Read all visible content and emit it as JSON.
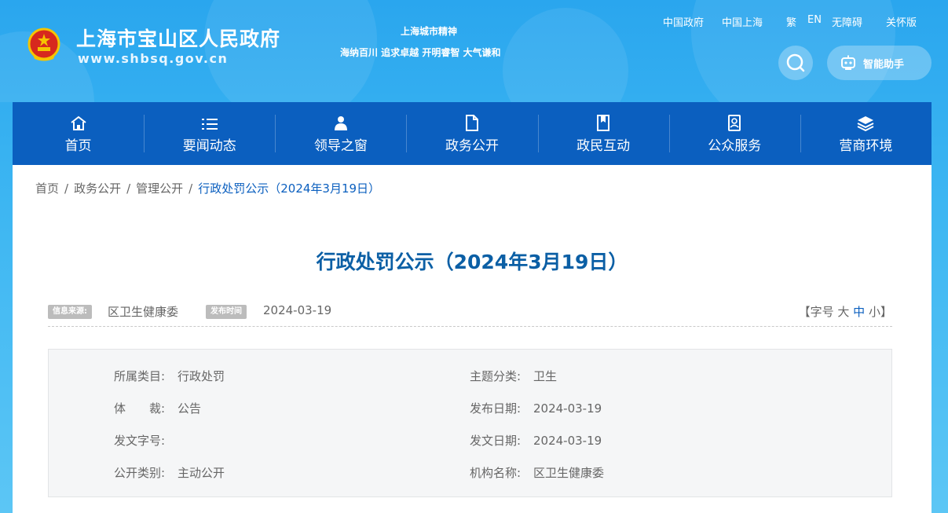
{
  "header": {
    "site_title": "上海市宝山区人民政府",
    "site_url": "www.shbsq.gov.cn",
    "spirit_title": "上海城市精神",
    "spirit_text": "海纳百川 追求卓越 开明睿智 大气谦和",
    "top_links": [
      "中国政府",
      "中国上海",
      "繁",
      "EN",
      "无障碍",
      "关怀版"
    ],
    "assistant_label": "智能助手",
    "icons": {
      "emblem": "national-emblem-icon",
      "search": "search-icon",
      "assistant": "robot-icon"
    }
  },
  "nav": {
    "items": [
      {
        "label": "首页",
        "icon": "home-icon"
      },
      {
        "label": "要闻动态",
        "icon": "list-icon"
      },
      {
        "label": "领导之窗",
        "icon": "person-icon"
      },
      {
        "label": "政务公开",
        "icon": "document-icon"
      },
      {
        "label": "政民互动",
        "icon": "bookmark-icon"
      },
      {
        "label": "公众服务",
        "icon": "service-icon"
      },
      {
        "label": "营商环境",
        "icon": "layers-icon"
      }
    ]
  },
  "breadcrumb": {
    "items": [
      "首页",
      "政务公开",
      "管理公开",
      "行政处罚公示（2024年3月19日）"
    ],
    "separator": "/"
  },
  "article": {
    "title": "行政处罚公示（2024年3月19日）",
    "source_tag": "信息来源:",
    "source_value": "区卫生健康委",
    "time_tag": "发布时间",
    "time_value": "2024-03-19",
    "font_size": {
      "open": "【字号",
      "large": "大",
      "medium": "中",
      "small": "小",
      "close": "】"
    }
  },
  "info": {
    "category_label": "所属类目:",
    "category_value": "行政处罚",
    "topic_label": "主题分类:",
    "topic_value": "卫生",
    "genre_label": "体　　裁:",
    "genre_value": "公告",
    "publish_date_label": "发布日期:",
    "publish_date_value": "2024-03-19",
    "doc_no_label": "发文字号:",
    "doc_no_value": "",
    "doc_date_label": "发文日期:",
    "doc_date_value": "2024-03-19",
    "open_type_label": "公开类别:",
    "open_type_value": "主动公开",
    "org_label": "机构名称:",
    "org_value": "区卫生健康委"
  },
  "colors": {
    "nav_bg": "#0b5fbf",
    "title": "#0b5fa5",
    "header_bg": "#2aa6ee"
  }
}
